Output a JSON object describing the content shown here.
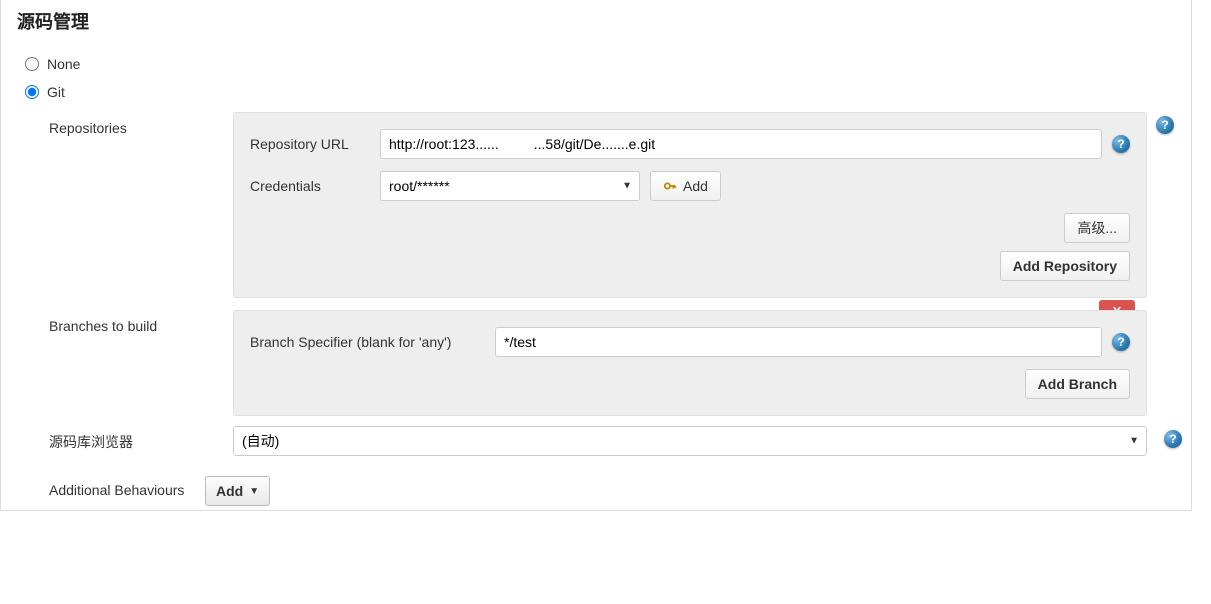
{
  "section": {
    "title": "源码管理"
  },
  "scm": {
    "none_label": "None",
    "git_label": "Git",
    "selected": "git"
  },
  "repositories": {
    "label": "Repositories",
    "url_label": "Repository URL",
    "url_value": "http://root:123......         ...58/git/De.......e.git",
    "credentials_label": "Credentials",
    "credentials_selected": "root/******",
    "add_credentials_label": "Add",
    "advanced_button": "高级...",
    "add_repo_button": "Add Repository"
  },
  "branches": {
    "label": "Branches to build",
    "specifier_label": "Branch Specifier (blank for 'any')",
    "specifier_value": "*/test",
    "delete_label": "X",
    "add_branch_button": "Add Branch"
  },
  "browser": {
    "label": "源码库浏览器",
    "selected": "(自动)"
  },
  "additional": {
    "label": "Additional Behaviours",
    "add_button": "Add"
  },
  "help_glyph": "?"
}
